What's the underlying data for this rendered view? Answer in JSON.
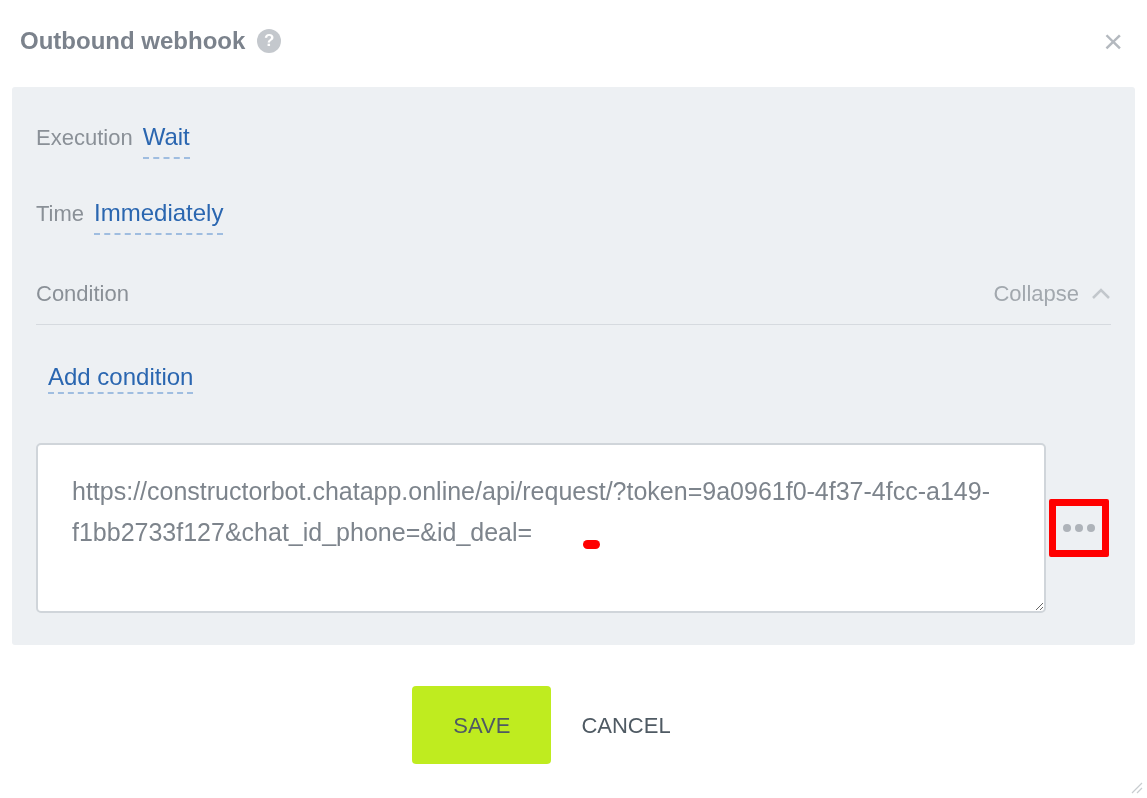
{
  "dialog": {
    "title": "Outbound webhook",
    "help": "?",
    "close": "×"
  },
  "settings": [
    {
      "label": "Execution",
      "value": "Wait"
    },
    {
      "label": "Time",
      "value": "Immediately"
    }
  ],
  "condition": {
    "label": "Condition",
    "toggle": "Collapse",
    "expanded": true,
    "add_link": "Add condition"
  },
  "request": {
    "url": "https://constructorbot.chatapp.online/api/request/?token=9a0961f0-4f37-4fcc-a149-f1bb2733f127&chat_id_phone=&id_deal=",
    "caret_marked": true
  },
  "more_button": {
    "highlighted": true
  },
  "buttons": [
    {
      "kind": "primary",
      "label": "SAVE"
    },
    {
      "kind": "plain",
      "label": "CANCEL"
    }
  ]
}
